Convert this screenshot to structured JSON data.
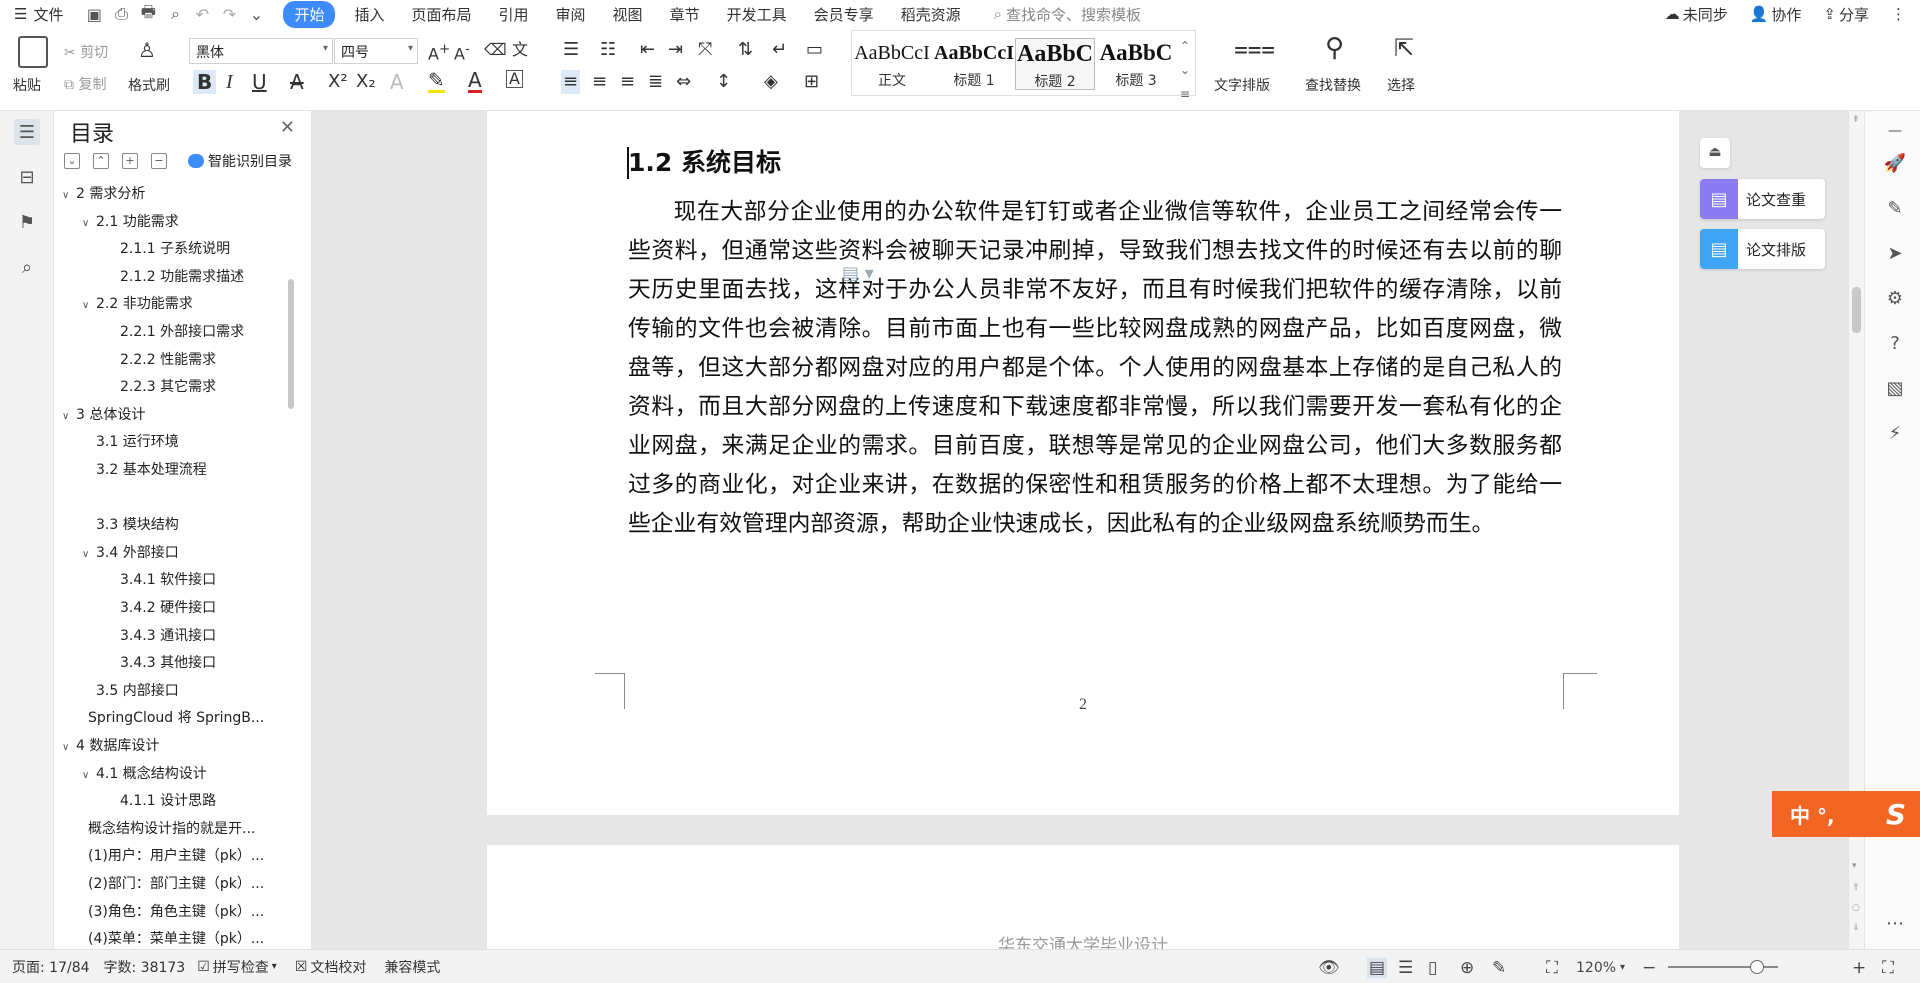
{
  "menubar": {
    "file_label": "文件",
    "tabs": [
      "开始",
      "插入",
      "页面布局",
      "引用",
      "审阅",
      "视图",
      "章节",
      "开发工具",
      "会员专享",
      "稻壳资源"
    ],
    "search_placeholder": "查找命令、搜索模板",
    "right": {
      "sync": "未同步",
      "collab": "协作",
      "share": "分享"
    }
  },
  "ribbon": {
    "paste": "粘贴",
    "cut": "剪切",
    "copy": "复制",
    "format_painter": "格式刷",
    "font_name": "黑体",
    "font_size": "四号",
    "styles": [
      {
        "sample": "AaBbCcI",
        "name": "正文"
      },
      {
        "sample": "AaBbCcI",
        "name": "标题 1"
      },
      {
        "sample": "AaBbC",
        "name": "标题 2"
      },
      {
        "sample": "AaBbC",
        "name": "标题 3"
      }
    ],
    "text_layout": "文字排版",
    "find_replace": "查找替换",
    "select": "选择"
  },
  "toc": {
    "title": "目录",
    "smart_label": "智能识别目录",
    "items": [
      {
        "text": "2  需求分析",
        "level": 0,
        "tw": "∨"
      },
      {
        "text": "2.1  功能需求",
        "level": 1,
        "tw": "∨"
      },
      {
        "text": "2.1.1  子系统说明",
        "level": 2,
        "tw": ""
      },
      {
        "text": "2.1.2  功能需求描述",
        "level": 2,
        "tw": ""
      },
      {
        "text": "2.2  非功能需求",
        "level": 1,
        "tw": "∨"
      },
      {
        "text": "2.2.1  外部接口需求",
        "level": 2,
        "tw": ""
      },
      {
        "text": "2.2.2  性能需求",
        "level": 2,
        "tw": ""
      },
      {
        "text": "2.2.3  其它需求",
        "level": 2,
        "tw": ""
      },
      {
        "text": "3  总体设计",
        "level": 0,
        "tw": "∨"
      },
      {
        "text": "3.1  运行环境",
        "level": 1,
        "tw": ""
      },
      {
        "text": "3.2  基本处理流程",
        "level": 1,
        "tw": ""
      },
      {
        "text": "",
        "level": 1,
        "tw": ""
      },
      {
        "text": "3.3  模块结构",
        "level": 1,
        "tw": ""
      },
      {
        "text": "3.4  外部接口",
        "level": 1,
        "tw": "∨"
      },
      {
        "text": "3.4.1  软件接口",
        "level": 2,
        "tw": ""
      },
      {
        "text": "3.4.2  硬件接口",
        "level": 2,
        "tw": ""
      },
      {
        "text": "3.4.3  通讯接口",
        "level": 2,
        "tw": ""
      },
      {
        "text": "3.4.3  其他接口",
        "level": 2,
        "tw": ""
      },
      {
        "text": "3.5  内部接口",
        "level": 1,
        "tw": ""
      },
      {
        "text": "SpringCloud 将 SpringB...",
        "level": 0,
        "tw": "",
        "plain": true
      },
      {
        "text": "4  数据库设计",
        "level": 0,
        "tw": "∨"
      },
      {
        "text": "4.1  概念结构设计",
        "level": 1,
        "tw": "∨"
      },
      {
        "text": "4.1.1  设计思路",
        "level": 2,
        "tw": ""
      },
      {
        "text": "概念结构设计指的就是开...",
        "level": 0,
        "tw": "",
        "plain": true
      },
      {
        "text": "(1)用户：用户主键（pk）...",
        "level": 0,
        "tw": "",
        "plain": true
      },
      {
        "text": "(2)部门：部门主键（pk）...",
        "level": 0,
        "tw": "",
        "plain": true
      },
      {
        "text": "(3)角色：角色主键（pk）...",
        "level": 0,
        "tw": "",
        "plain": true
      },
      {
        "text": "(4)菜单：菜单主键（pk）...",
        "level": 0,
        "tw": "",
        "plain": true
      }
    ]
  },
  "document": {
    "heading": "1.2  系统目标",
    "paragraph": "现在大部分企业使用的办公软件是钉钉或者企业微信等软件，企业员工之间经常会传一些资料，但通常这些资料会被聊天记录冲刷掉，导致我们想去找文件的时候还有去以前的聊天历史里面去找，这样对于办公人员非常不友好，而且有时候我们把软件的缓存清除，以前传输的文件也会被清除。目前市面上也有一些比较网盘成熟的网盘产品，比如百度网盘，微盘等，但这大部分都网盘对应的用户都是个体。个人使用的网盘基本上存储的是自己私人的资料，而且大部分网盘的上传速度和下载速度都非常慢，所以我们需要开发一套私有化的企业网盘，来满足企业的需求。目前百度，联想等是常见的企业网盘公司，他们大多数服务都过多的商业化，对企业来讲，在数据的保密性和租赁服务的价格上都不太理想。为了能给一些企业有效管理内部资源，帮助企业快速成长，因此私有的企业级网盘系统顺势而生。",
    "page_number": "2",
    "next_page_header": "华东交通大学毕业设计"
  },
  "right_panel": {
    "check": "论文查重",
    "format": "论文排版"
  },
  "ime": {
    "text": "中 °,"
  },
  "status": {
    "page": "页面: 17/84",
    "words": "字数: 38173",
    "spell": "拼写检查",
    "proof": "文档校对",
    "compat": "兼容模式",
    "zoom": "120%"
  },
  "colors": {
    "accent": "#3d8bfd",
    "ime": "#f26522",
    "check_icon": "#8b7cf6",
    "format_icon": "#3da5f4"
  }
}
